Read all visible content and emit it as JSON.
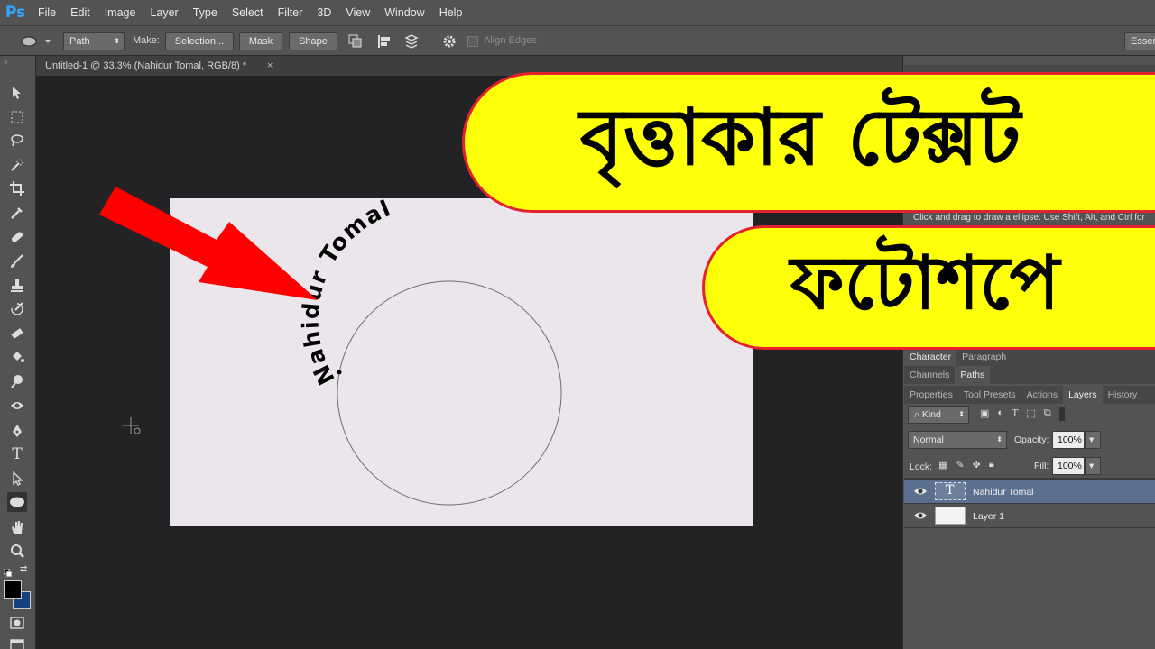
{
  "app": {
    "logo": "Ps"
  },
  "menu": [
    "File",
    "Edit",
    "Image",
    "Layer",
    "Type",
    "Select",
    "Filter",
    "3D",
    "View",
    "Window",
    "Help"
  ],
  "options_bar": {
    "path_select": "Path",
    "make_label": "Make:",
    "selection_button": "Selection...",
    "mask_button": "Mask",
    "shape_button": "Shape",
    "align_edges_label": "Align Edges",
    "workspace_button": "Essen"
  },
  "document": {
    "tab_title": "Untitled-1 @ 33.3% (Nahidur Tomal, RGB/8) *",
    "close_glyph": "×",
    "path_text": "Nahidur Tomal"
  },
  "banners": {
    "line1": "বৃত্তাকার টেক্সট",
    "line2": "ফটোশপে"
  },
  "panels": {
    "hint": "Click and drag to draw a ellipse.  Use Shift, Alt, and Ctrl for",
    "character_tabs": [
      "Character",
      "Paragraph"
    ],
    "channel_tabs": [
      "Channels",
      "Paths"
    ],
    "layer_tabs": [
      "Properties",
      "Tool Presets",
      "Actions",
      "Layers",
      "History"
    ],
    "kind_filter": "Kind",
    "blend_mode": "Normal",
    "opacity_label": "Opacity:",
    "opacity_value": "100%",
    "lock_label": "Lock:",
    "fill_label": "Fill:",
    "fill_value": "100%",
    "layers": [
      {
        "name": "Nahidur Tomal",
        "type": "text",
        "selected": true
      },
      {
        "name": "Layer 1",
        "type": "pixel",
        "selected": false
      }
    ]
  },
  "colors": {
    "banner_fill": "#ffff08",
    "banner_border": "#e5212e",
    "arrow": "#fe0000",
    "selected_layer": "#5b6f8f"
  }
}
